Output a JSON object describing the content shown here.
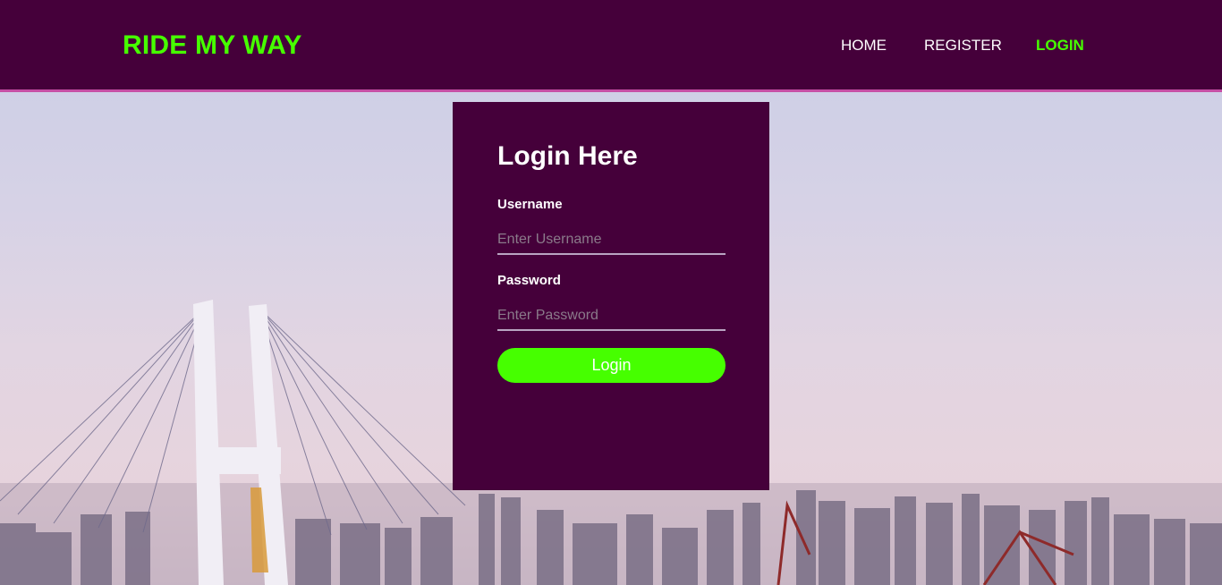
{
  "brand": {
    "name": "RIDE MY WAY"
  },
  "nav": {
    "home": "HOME",
    "register": "REGISTER",
    "login": "LOGIN"
  },
  "login_form": {
    "title": "Login Here",
    "username_label": "Username",
    "username_placeholder": "Enter Username",
    "password_label": "Password",
    "password_placeholder": "Enter Password",
    "submit_label": "Login"
  },
  "colors": {
    "header_bg": "#45003a",
    "accent_green": "#46ff00",
    "header_border": "#c64fa5"
  }
}
